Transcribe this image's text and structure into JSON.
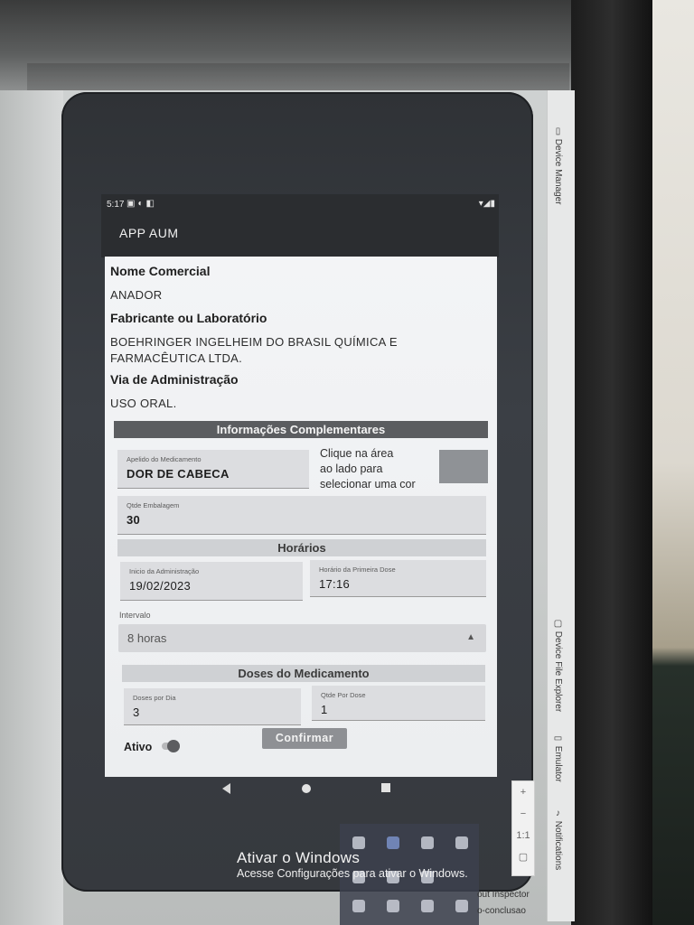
{
  "status_bar": {
    "time": "5:17"
  },
  "app": {
    "title": "APP AUM"
  },
  "medicine": {
    "commercial_name_label": "Nome Comercial",
    "commercial_name_value": "ANADOR",
    "manufacturer_label": "Fabricante ou Laboratório",
    "manufacturer_value_line1": "BOEHRINGER INGELHEIM DO BRASIL QUÍMICA E",
    "manufacturer_value_line2": "FARMACÊUTICA LTDA.",
    "route_label": "Via de Administração",
    "route_value": "USO ORAL."
  },
  "complementary": {
    "title": "Informações Complementares",
    "nickname_label": "Apelido do Medicamento",
    "nickname_value": "DOR DE CABECA",
    "color_hint_line1": "Clique na área",
    "color_hint_line2": "ao lado para",
    "color_hint_line3": "selecionar uma cor",
    "swatch_color": "#8f9296",
    "package_qty_label": "Qtde Embalagem",
    "package_qty_value": "30"
  },
  "schedule": {
    "title": "Horários",
    "start_label": "Inicio da Administração",
    "start_value": "19/02/2023",
    "first_dose_label": "Horário da Primeira Dose",
    "first_dose_value": "17:16",
    "interval_label": "Intervalo",
    "interval_value": "8 horas"
  },
  "doses": {
    "title": "Doses do Medicamento",
    "per_day_label": "Doses por Dia",
    "per_day_value": "3",
    "per_dose_label": "Qtde Por Dose",
    "per_dose_value": "1"
  },
  "form": {
    "active_label": "Ativo",
    "confirm_label": "Confirmar"
  },
  "emulator_controls": {
    "zoom_in": "+",
    "zoom_out": "−",
    "ratio": "1:1"
  },
  "ide": {
    "device_manager": "Device Manager",
    "device_file_explorer": "Device File Explorer",
    "emulator": "Emulator",
    "notifications": "Notifications",
    "layout_inspector": "out Inspector",
    "file_hint": "o-conclusao"
  },
  "windows": {
    "activate_title": "Ativar o Windows",
    "activate_sub": "Acesse Configurações para ativar o Windows."
  }
}
